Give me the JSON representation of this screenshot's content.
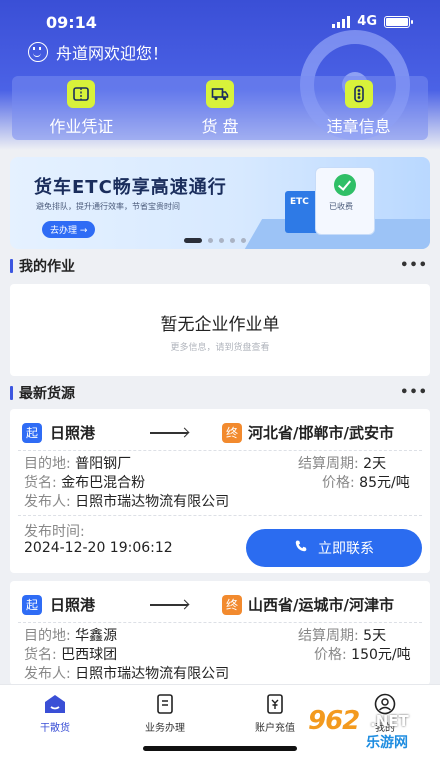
{
  "status": {
    "time": "09:14",
    "network": "4G"
  },
  "header": {
    "welcome": "舟道网欢迎您！",
    "quick_actions": [
      {
        "label": "作业凭证",
        "icon": "voucher-icon"
      },
      {
        "label": "货 盘",
        "icon": "truck-icon"
      },
      {
        "label": "违章信息",
        "icon": "traffic-light-icon"
      }
    ]
  },
  "banner": {
    "title": "货车ETC畅享高速通行",
    "subtitle": "避免排队，提升通行效率，节省宝贵时间",
    "button": "去办理 →",
    "gate_text": "ETC",
    "toll_text": "已收费",
    "active_dot": 0,
    "dot_count": 5
  },
  "my_work": {
    "title": "我的作业",
    "more": "•••",
    "empty_title": "暂无企业作业单",
    "empty_sub": "更多信息，请到货盘查看"
  },
  "latest": {
    "title": "最新货源",
    "more": "•••",
    "start_tag": "起",
    "end_tag": "终",
    "labels": {
      "destination": "目的地:",
      "cargo": "货名:",
      "publisher": "发布人:",
      "cycle": "结算周期:",
      "price": "价格:",
      "publish_time": "发布时间:",
      "contact": "立即联系"
    },
    "items": [
      {
        "origin": "日照港",
        "dest_region": "河北省/邯郸市/武安市",
        "destination": "普阳钢厂",
        "cargo": "金布巴混合粉",
        "publisher": "日照市瑞达物流有限公司",
        "cycle": "2天",
        "price": "85元/吨",
        "publish_time": "2024-12-20 19:06:12"
      },
      {
        "origin": "日照港",
        "dest_region": "山西省/运城市/河津市",
        "destination": "华鑫源",
        "cargo": "巴西球团",
        "publisher": "日照市瑞达物流有限公司",
        "cycle": "5天",
        "price": "150元/吨"
      }
    ]
  },
  "nav": {
    "items": [
      {
        "label": "干散货",
        "active": true
      },
      {
        "label": "业务办理",
        "active": false
      },
      {
        "label": "账户充值",
        "active": false
      },
      {
        "label": "我的",
        "active": false
      }
    ]
  },
  "watermark": {
    "number": "962",
    "net": ".NET",
    "sub": "乐游网"
  },
  "colors": {
    "primary": "#3a4fd6",
    "accent_button": "#2b6cf0",
    "start_tag": "#2f6cf5",
    "end_tag": "#f28a2e",
    "quick_icon": "#d8f23a"
  }
}
